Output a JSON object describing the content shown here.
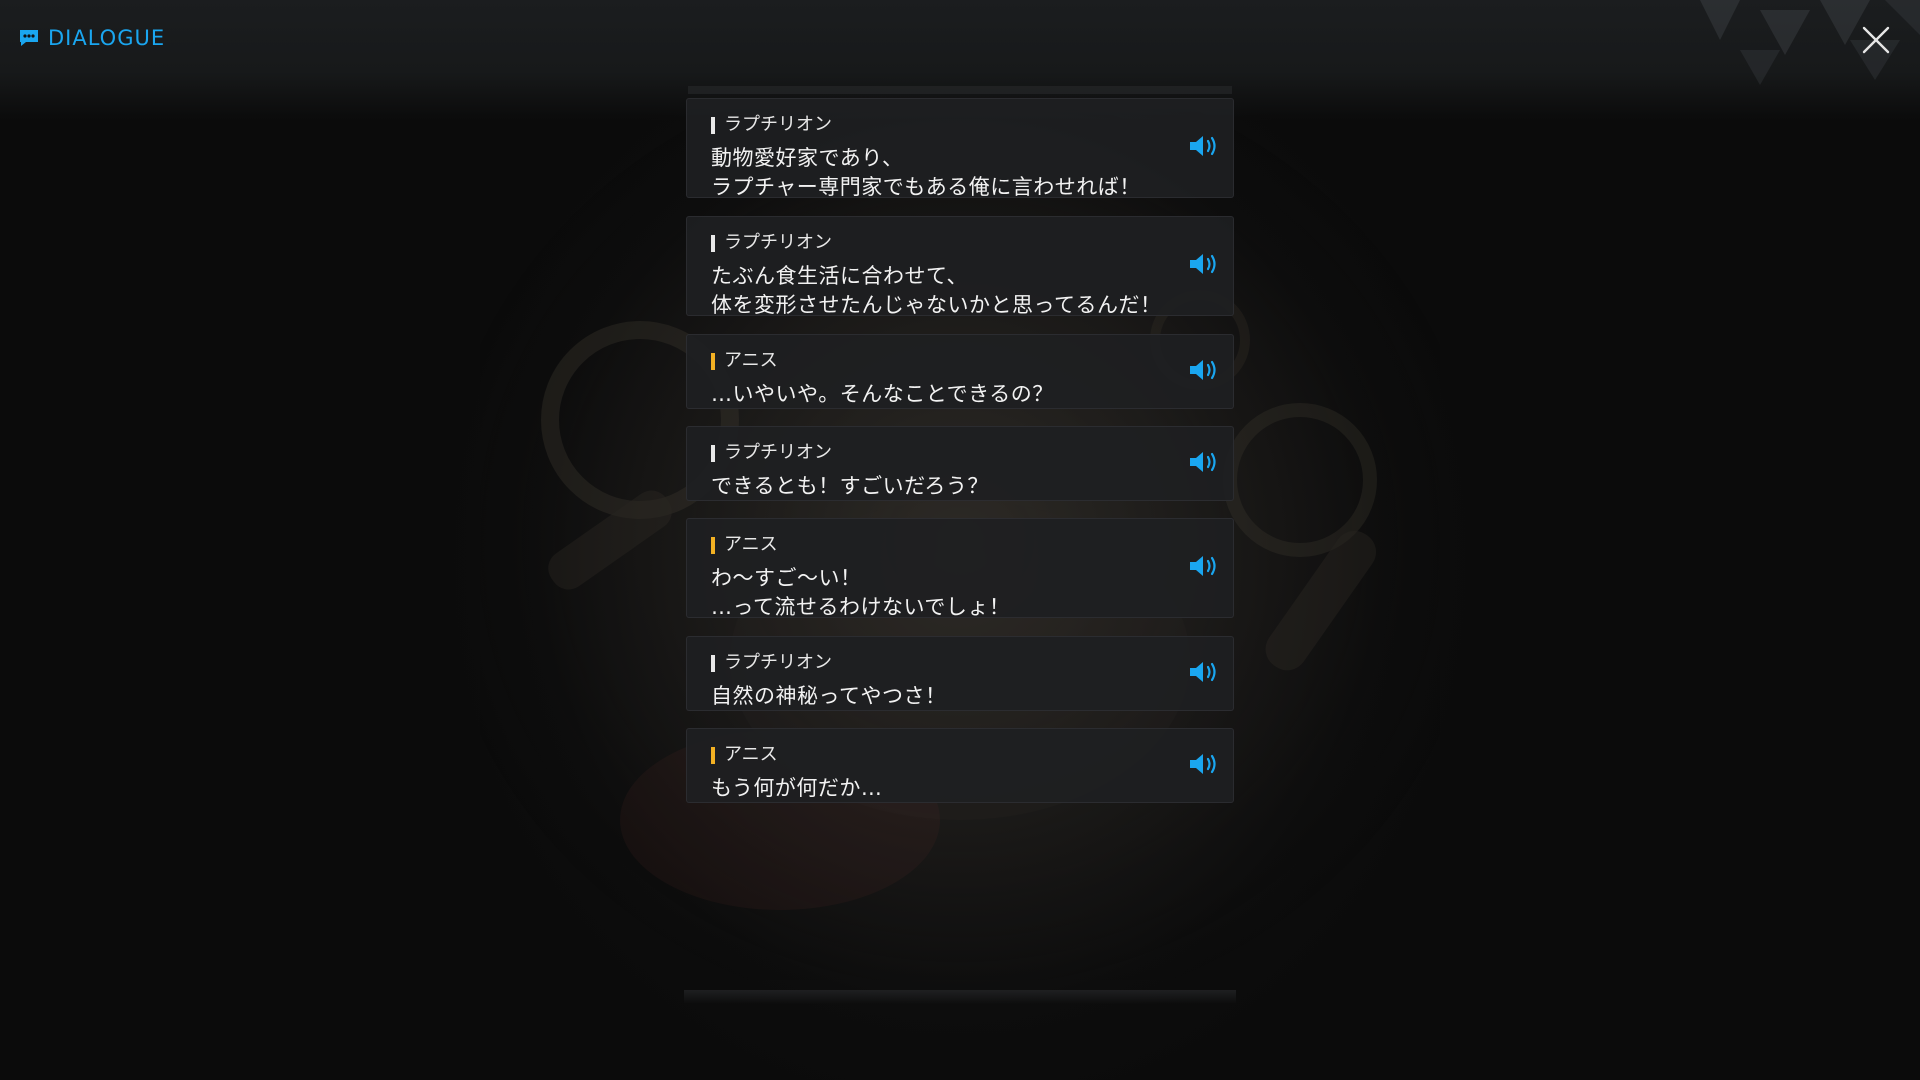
{
  "header": {
    "title": "DIALOGUE",
    "title_icon": "chat-bubble-icon",
    "close_icon": "close-icon"
  },
  "colors": {
    "accent": "#1aa6f0",
    "speaker_marker_default": "#e9e9e9",
    "speaker_marker_anis": "#f3b123",
    "card_bg": "#1e1f21",
    "text": "#f2f2f2"
  },
  "dialogue": [
    {
      "speaker": "ラプチリオン",
      "marker": "white",
      "lines": [
        "動物愛好家であり、",
        "ラプチャー専門家でもある俺に言わせれば！"
      ],
      "voice_icon": "speaker-volume-icon"
    },
    {
      "speaker": "ラプチリオン",
      "marker": "white",
      "lines": [
        "たぶん食生活に合わせて、",
        "体を変形させたんじゃないかと思ってるんだ！"
      ],
      "voice_icon": "speaker-volume-icon"
    },
    {
      "speaker": "アニス",
      "marker": "gold",
      "lines": [
        "…いやいや。そんなことできるの？"
      ],
      "voice_icon": "speaker-volume-icon"
    },
    {
      "speaker": "ラプチリオン",
      "marker": "white",
      "lines": [
        "できるとも！すごいだろう？"
      ],
      "voice_icon": "speaker-volume-icon"
    },
    {
      "speaker": "アニス",
      "marker": "gold",
      "lines": [
        "わ～すご～い！",
        "…って流せるわけないでしょ！"
      ],
      "voice_icon": "speaker-volume-icon"
    },
    {
      "speaker": "ラプチリオン",
      "marker": "white",
      "lines": [
        "自然の神秘ってやつさ！"
      ],
      "voice_icon": "speaker-volume-icon"
    },
    {
      "speaker": "アニス",
      "marker": "gold",
      "lines": [
        "もう何が何だか…"
      ],
      "voice_icon": "speaker-volume-icon"
    }
  ]
}
